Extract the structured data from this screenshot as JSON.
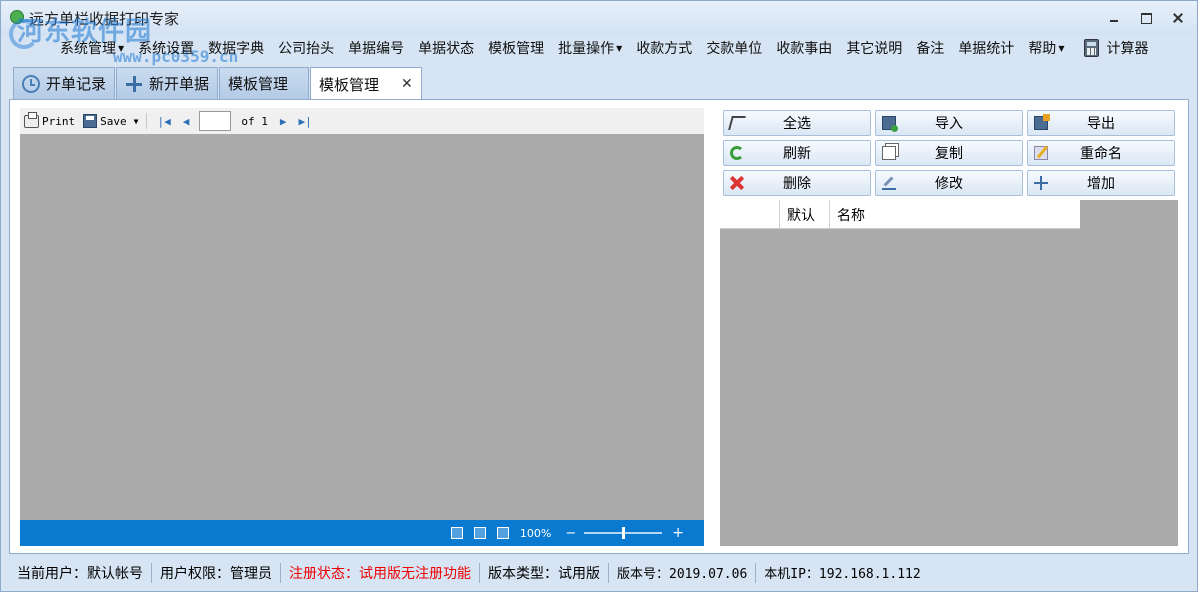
{
  "window": {
    "title": "远方单栏收据打印专家",
    "watermark_text": "河东软件园",
    "watermark_url": "www.pc0359.cn"
  },
  "menu": {
    "items": [
      {
        "label": "系统管理",
        "has_caret": true
      },
      {
        "label": "系统设置"
      },
      {
        "label": "数据字典"
      },
      {
        "label": "公司抬头"
      },
      {
        "label": "单据编号"
      },
      {
        "label": "单据状态"
      },
      {
        "label": "模板管理"
      },
      {
        "label": "批量操作",
        "has_caret": true
      },
      {
        "label": "收款方式"
      },
      {
        "label": "交款单位"
      },
      {
        "label": "收款事由"
      },
      {
        "label": "其它说明"
      },
      {
        "label": "备注"
      },
      {
        "label": "单据统计"
      },
      {
        "label": "帮助",
        "has_caret": true
      }
    ],
    "calculator": {
      "label": "计算器",
      "icon": "calculator-icon"
    }
  },
  "tabs": [
    {
      "label": "开单记录",
      "icon": "clock-icon"
    },
    {
      "label": "新开单据",
      "icon": "plus-icon"
    },
    {
      "label": "模板管理"
    },
    {
      "label": "模板管理",
      "active": true,
      "close": "✕"
    }
  ],
  "viewer": {
    "print_label": "Print",
    "save_label": "Save",
    "page_value": "",
    "of_label": "of 1",
    "zoom_label": "100%",
    "zoom_minus": "−",
    "zoom_plus": "+"
  },
  "actions": [
    {
      "label": "全选",
      "icon": "cursor-icon"
    },
    {
      "label": "导入",
      "icon": "import-icon"
    },
    {
      "label": "导出",
      "icon": "export-icon"
    },
    {
      "label": "刷新",
      "icon": "refresh-icon"
    },
    {
      "label": "复制",
      "icon": "copy-icon"
    },
    {
      "label": "重命名",
      "icon": "rename-icon"
    },
    {
      "label": "删除",
      "icon": "delete-icon"
    },
    {
      "label": "修改",
      "icon": "edit-icon"
    },
    {
      "label": "增加",
      "icon": "add-icon"
    }
  ],
  "grid": {
    "columns": [
      "",
      "默认",
      "名称"
    ]
  },
  "status": {
    "user": "当前用户：默认帐号",
    "permission": "用户权限：管理员",
    "registration": "注册状态：试用版无注册功能",
    "version_type": "版本类型：试用版",
    "version_no": "版本号：2019.07.06",
    "ip": "本机IP：192.168.1.112"
  },
  "colors": {
    "status_bar_blue": "#0a7ad1",
    "registration_red": "#e00000",
    "viewer_gray": "#ababab"
  }
}
